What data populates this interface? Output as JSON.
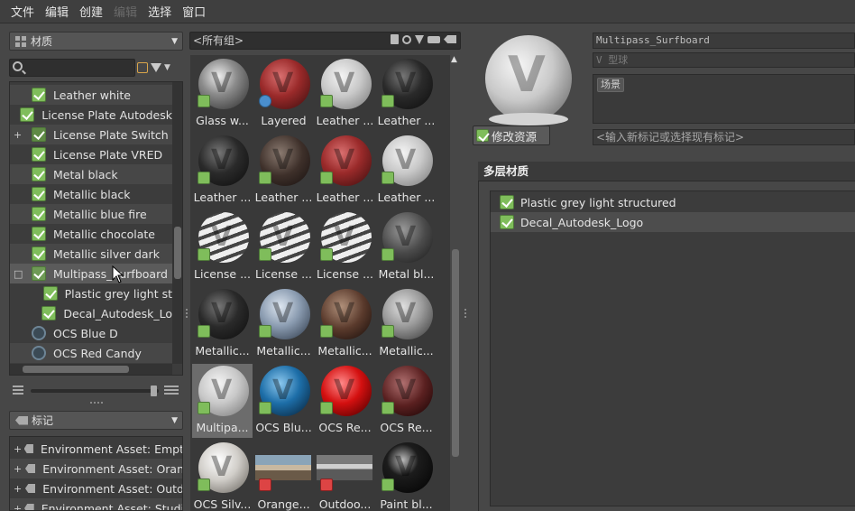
{
  "menubar": {
    "items": [
      {
        "label": "文件",
        "enabled": true
      },
      {
        "label": "编辑",
        "enabled": true
      },
      {
        "label": "创建",
        "enabled": true
      },
      {
        "label": "编辑",
        "enabled": false
      },
      {
        "label": "选择",
        "enabled": true
      },
      {
        "label": "窗口",
        "enabled": true
      }
    ]
  },
  "left": {
    "category_dropdown": {
      "label": "材质"
    },
    "search": {
      "placeholder": ""
    },
    "tree": [
      {
        "label": "Leather white",
        "icon": "check",
        "alt": true
      },
      {
        "label": "License Plate Autodesk",
        "icon": "check",
        "alt": false
      },
      {
        "label": "License Plate Switch",
        "icon": "switch",
        "alt": true,
        "expander": "+"
      },
      {
        "label": "License Plate VRED",
        "icon": "check",
        "alt": false
      },
      {
        "label": "Metal black",
        "icon": "check",
        "alt": true
      },
      {
        "label": "Metallic black",
        "icon": "check",
        "alt": false
      },
      {
        "label": "Metallic blue fire",
        "icon": "check",
        "alt": true
      },
      {
        "label": "Metallic chocolate",
        "icon": "check",
        "alt": false
      },
      {
        "label": "Metallic silver dark",
        "icon": "check",
        "alt": true
      },
      {
        "label": "Multipass_Surfboard",
        "icon": "multi",
        "selected": true,
        "expander": "□"
      },
      {
        "label": "Plastic grey light st",
        "icon": "check",
        "child": true
      },
      {
        "label": "Decal_Autodesk_Lo",
        "icon": "check",
        "child": true
      },
      {
        "label": "OCS Blue D",
        "icon": "ocs",
        "alt": false
      },
      {
        "label": "OCS Red Candy",
        "icon": "ocs",
        "alt": true
      }
    ],
    "tags_dropdown": {
      "label": "标记"
    },
    "tag_items": [
      {
        "label": "Environment Asset: Empt"
      },
      {
        "label": "Environment Asset: Oran"
      },
      {
        "label": "Environment Asset: Outd"
      },
      {
        "label": "Environment Asset: Studi"
      }
    ]
  },
  "middle": {
    "group_filter": "<所有组>",
    "thumbnails": [
      {
        "label": "Glass w...",
        "style": "glass",
        "badge": "check"
      },
      {
        "label": "Layered",
        "style": "red",
        "badge": "blue"
      },
      {
        "label": "Leather ...",
        "style": "lightgrey",
        "badge": "check"
      },
      {
        "label": "Leather ...",
        "style": "black",
        "badge": "check"
      },
      {
        "label": "Leather ...",
        "style": "black",
        "badge": "check"
      },
      {
        "label": "Leather ...",
        "style": "darkbrown",
        "badge": "check"
      },
      {
        "label": "Leather ...",
        "style": "red",
        "badge": "check"
      },
      {
        "label": "Leather ...",
        "style": "lightgrey",
        "badge": "check"
      },
      {
        "label": "License ...",
        "style": "zebra",
        "badge": "check"
      },
      {
        "label": "License ...",
        "style": "zebra",
        "badge": "check"
      },
      {
        "label": "License ...",
        "style": "zebra",
        "badge": "check"
      },
      {
        "label": "Metal bl...",
        "style": "darkgrey",
        "badge": "check"
      },
      {
        "label": "Metallic...",
        "style": "black",
        "badge": "check"
      },
      {
        "label": "Metallic...",
        "style": "bluegrey",
        "badge": "check"
      },
      {
        "label": "Metallic...",
        "style": "brown",
        "badge": "check"
      },
      {
        "label": "Metallic...",
        "style": "silver",
        "badge": "check"
      },
      {
        "label": "Multipa...",
        "style": "lightgrey",
        "badge": "check",
        "selected": true
      },
      {
        "label": "OCS Blu...",
        "style": "blue",
        "badge": "check"
      },
      {
        "label": "OCS Re...",
        "style": "brightred",
        "badge": "check"
      },
      {
        "label": "OCS Re...",
        "style": "darkred",
        "badge": "check"
      },
      {
        "label": "OCS Silv...",
        "style": "white",
        "badge": "check"
      },
      {
        "label": "Orange...",
        "style": "env-orange",
        "badge": "red"
      },
      {
        "label": "Outdoo...",
        "style": "env-outdoor",
        "badge": "red"
      },
      {
        "label": "Paint bl...",
        "style": "gloss-black",
        "badge": "check"
      }
    ]
  },
  "right": {
    "material_name": "Multipass_Surfboard",
    "type_field": "V 型球",
    "tag_chip": "场景",
    "edit_button": "修改资源",
    "tag_input_placeholder": "<输入新标记或选择现有标记>",
    "layer_section_title": "多层材质",
    "layers": [
      {
        "label": "Plastic grey light structured"
      },
      {
        "label": "Decal_Autodesk_Logo"
      }
    ]
  },
  "colors": {
    "check_green": "#7fbd5b",
    "panel_bg": "#474747",
    "list_bg": "#3c3c3c"
  }
}
